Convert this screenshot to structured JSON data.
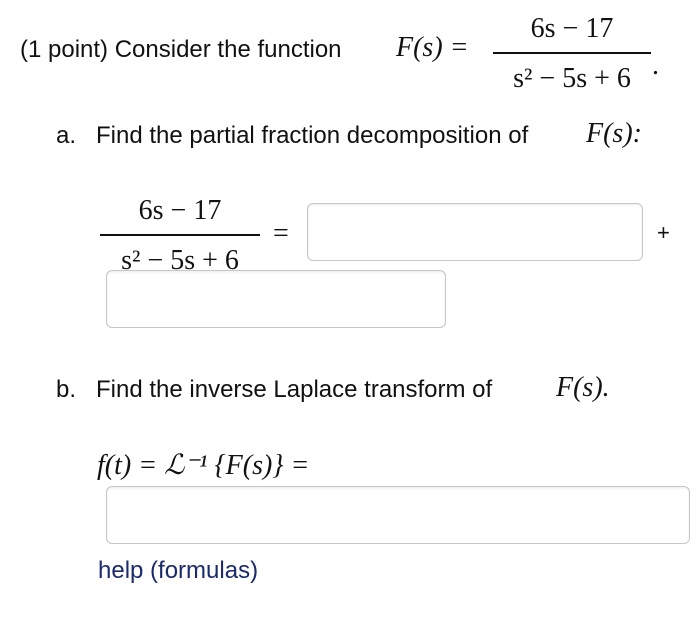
{
  "intro": {
    "prefix": "(1 point) Consider the function",
    "lhs": "F(s) =",
    "numerator": "6s − 17",
    "denominator": "s² − 5s + 6",
    "period": "."
  },
  "part_a": {
    "label": "a.",
    "text": "Find the partial fraction decomposition of",
    "expr": "F(s):",
    "eq_numerator": "6s − 17",
    "eq_denominator": "s² − 5s + 6",
    "equals": "=",
    "plus": "+",
    "input1_value": "",
    "input2_value": ""
  },
  "part_b": {
    "label": "b.",
    "text": "Find the inverse Laplace transform of",
    "expr": "F(s).",
    "formula": "f(t) = ℒ⁻¹ {F(s)} =",
    "input_value": ""
  },
  "help_link": "help (formulas)"
}
